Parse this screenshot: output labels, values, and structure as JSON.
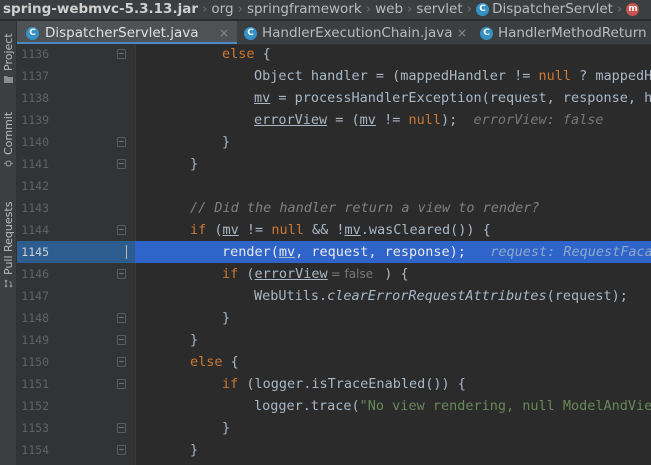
{
  "breadcrumb": {
    "items": [
      "spring-webmvc-5.3.13.jar",
      "org",
      "springframework",
      "web",
      "servlet",
      "DispatcherServlet"
    ],
    "class_badge": "C",
    "method_badge": "m"
  },
  "toolwindows": {
    "project": "Project",
    "commit": "Commit",
    "pull_requests": "Pull Requests"
  },
  "tabs": [
    {
      "label": "DispatcherServlet.java",
      "icon": "C",
      "close": "×",
      "active": true
    },
    {
      "label": "HandlerExecutionChain.java",
      "icon": "C",
      "close": "×",
      "active": false
    },
    {
      "label": "HandlerMethodReturn",
      "icon": "C",
      "active": false
    }
  ],
  "editor": {
    "lines": [
      {
        "num": "1136"
      },
      {
        "num": "1137"
      },
      {
        "num": "1138"
      },
      {
        "num": "1139"
      },
      {
        "num": "1140"
      },
      {
        "num": "1141"
      },
      {
        "num": "1142"
      },
      {
        "num": "1143"
      },
      {
        "num": "1144"
      },
      {
        "num": "1145"
      },
      {
        "num": "1146"
      },
      {
        "num": "1147"
      },
      {
        "num": "1148"
      },
      {
        "num": "1149"
      },
      {
        "num": "1150"
      },
      {
        "num": "1151"
      },
      {
        "num": "1152"
      },
      {
        "num": "1153"
      },
      {
        "num": "1154"
      }
    ],
    "tokens": {
      "else": "else",
      "brace_open": " {",
      "brace_close": "}",
      "l1137_a": "Object handler = (mappedHandler != ",
      "l1137_null": "null",
      "l1137_b": " ? mappedHa",
      "l1138_mv": "mv",
      "l1138_rest": " = processHandlerException(request, response, ha",
      "l1139_ev": "errorView",
      "l1139_mid": " = (",
      "l1139_mv": "mv",
      "l1139_ne": " != ",
      "l1139_null": "null",
      "l1139_end": ");",
      "l1139_inline": "errorView: false",
      "l1143_comment": "// Did the handler return a view to render?",
      "l1144_if": "if",
      "l1144_a": " (",
      "l1144_mv": "mv",
      "l1144_b": " != ",
      "l1144_null": "null",
      "l1144_c": " && !",
      "l1144_mv2": "mv",
      "l1144_d": ".wasCleared()) {",
      "l1145_a": "render(",
      "l1145_mv": "mv",
      "l1145_b": ", request, response);",
      "l1145_inline": "request: RequestFacad",
      "l1146_if": "if",
      "l1146_a": " (",
      "l1146_ev": "errorView",
      "l1146_hint": "= false",
      "l1146_b": " ) {",
      "l1147_a": "WebUtils.",
      "l1147_m": "clearErrorRequestAttributes",
      "l1147_b": "(request);",
      "l1151_if": "if",
      "l1151_a": " (logger.isTraceEnabled()) {",
      "l1152_a": "logger.trace(",
      "l1152_str": "\"No view rendering, null ModelAndView"
    }
  },
  "colors": {
    "editor_bg": "#2b2b2b",
    "gutter_bg": "#313335",
    "execution_line": "#2f65ca",
    "keyword": "#cc7832",
    "comment": "#808080",
    "string": "#6a8759"
  }
}
